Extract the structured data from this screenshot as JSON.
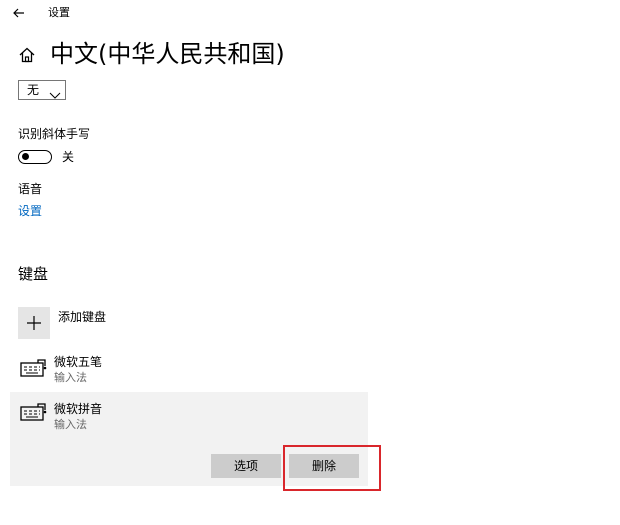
{
  "window": {
    "title": "设置"
  },
  "header": {
    "title": "中文(中华人民共和国)"
  },
  "dropdown": {
    "value": "无"
  },
  "handwriting": {
    "label": "识别斜体手写",
    "toggle_state": "关"
  },
  "speech": {
    "label": "语音",
    "link": "设置"
  },
  "keyboard": {
    "section_title": "键盘",
    "add_label": "添加键盘",
    "items": [
      {
        "title": "微软五笔",
        "subtitle": "输入法"
      },
      {
        "title": "微软拼音",
        "subtitle": "输入法"
      }
    ],
    "options_button": "选项",
    "delete_button": "删除"
  },
  "colors": {
    "accent": "#0067c0",
    "highlight": "#d9262b",
    "panel": "#f2f2f2",
    "button": "#cccccc"
  }
}
